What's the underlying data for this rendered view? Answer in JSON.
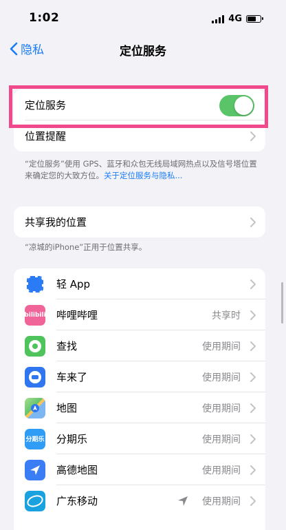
{
  "status_bar": {
    "time": "1:02",
    "network": "4G",
    "battery_level": 0.7
  },
  "nav": {
    "back_label": "隐私",
    "title": "定位服务"
  },
  "location_section": {
    "toggle_label": "定位服务",
    "toggle_on": true,
    "alerts_label": "位置提醒"
  },
  "location_footnote": {
    "text": "“定位服务”使用 GPS、蓝牙和众包无线局域网热点以及信号塔位置来确定您的大致方位。",
    "link": "关于定位服务与隐私..."
  },
  "share_section": {
    "label": "共享我的位置"
  },
  "share_footnote": {
    "text": "“凉城的iPhone”正用于位置共享。"
  },
  "apps": [
    {
      "name": "轻 App",
      "status": "",
      "icon": "light-app-icon",
      "color": "#2b7bf6"
    },
    {
      "name": "哔哩哔哩",
      "status": "共享时",
      "icon": "bilibili-icon",
      "color": "#f0649a",
      "glyph": "bilibili"
    },
    {
      "name": "查找",
      "status": "使用期间",
      "icon": "find-my-icon",
      "color": "#4fc35c"
    },
    {
      "name": "车来了",
      "status": "使用期间",
      "icon": "chelaile-icon",
      "color": "#2f76f0"
    },
    {
      "name": "地图",
      "status": "使用期间",
      "icon": "maps-icon",
      "color": "#64c36d"
    },
    {
      "name": "分期乐",
      "status": "使用期间",
      "icon": "fenqile-icon",
      "color": "#2f9cf6",
      "glyph": "分期乐"
    },
    {
      "name": "高德地图",
      "status": "使用期间",
      "icon": "amap-icon",
      "color": "#3a7df4"
    },
    {
      "name": "广东移动",
      "status": "使用期间",
      "icon": "china-mobile-icon",
      "color": "#1aa2e0",
      "recent_use": true
    }
  ],
  "colors": {
    "accent": "#1a7cf5",
    "toggle_on": "#5ac468",
    "highlight": "#f04a8c"
  }
}
